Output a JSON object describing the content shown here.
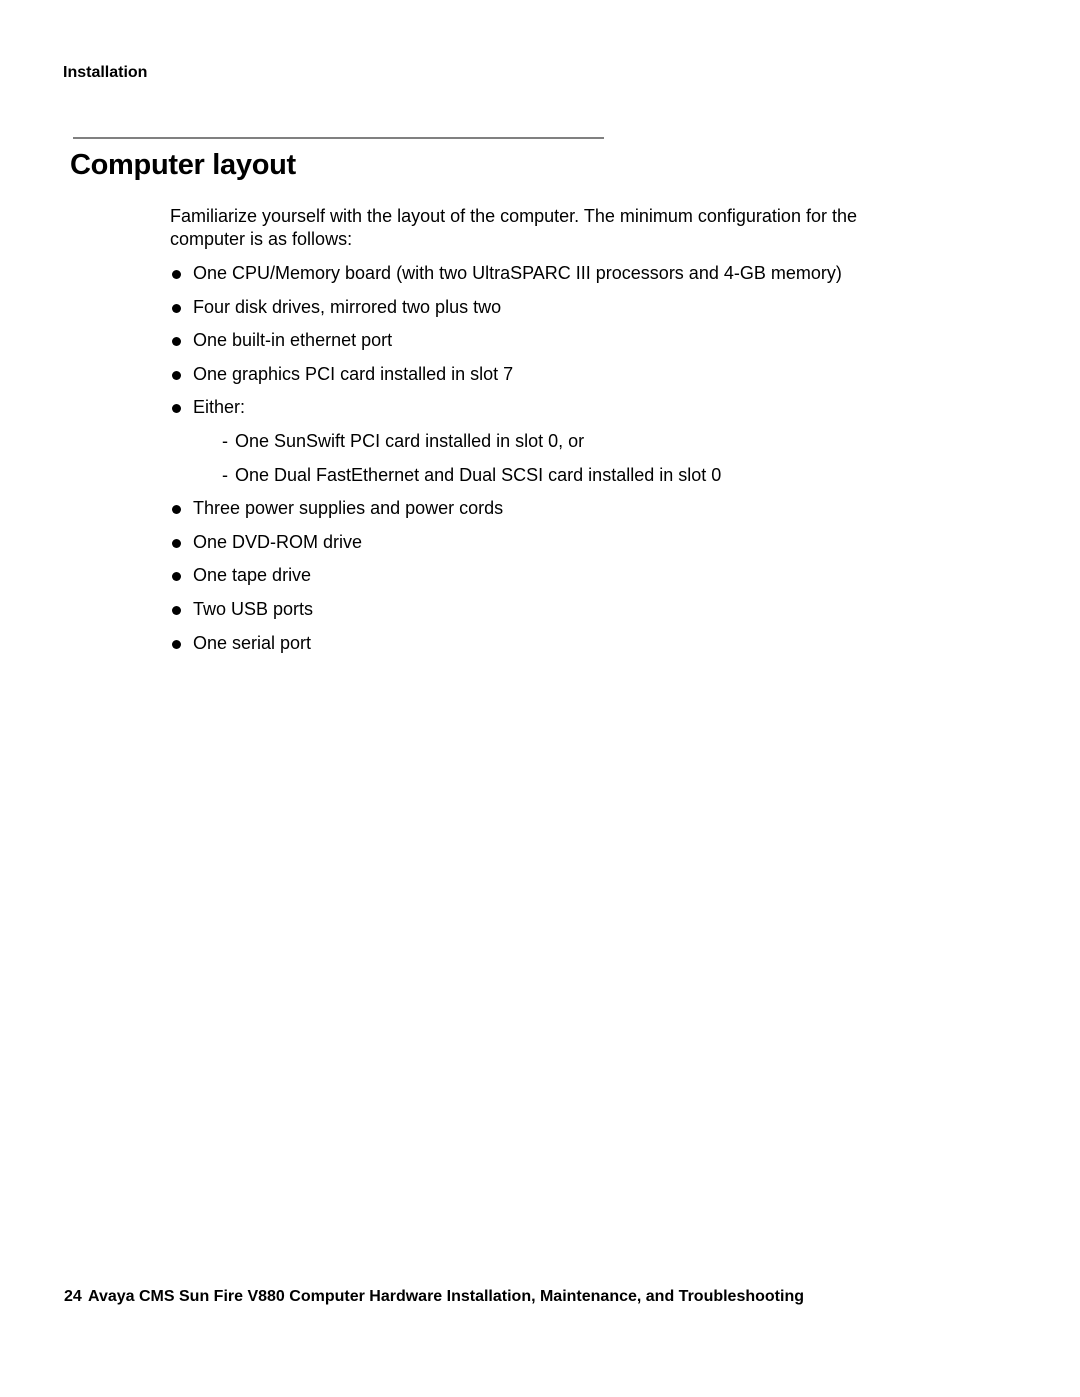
{
  "header": {
    "section": "Installation"
  },
  "page": {
    "title": "Computer layout",
    "intro": "Familiarize yourself with the layout of the computer. The minimum configuration for the computer is as follows:",
    "items": [
      {
        "type": "bullet",
        "text": "One CPU/Memory board (with two UltraSPARC III processors and 4-GB memory)"
      },
      {
        "type": "bullet",
        "text": "Four disk drives, mirrored two plus two"
      },
      {
        "type": "bullet",
        "text": "One built-in ethernet port"
      },
      {
        "type": "bullet",
        "text": "One graphics PCI card installed in slot 7"
      },
      {
        "type": "bullet",
        "text": "Either:"
      },
      {
        "type": "sub",
        "marker": "-",
        "text": "One SunSwift PCI card installed in slot 0, or"
      },
      {
        "type": "sub",
        "marker": "-",
        "text": "One Dual FastEthernet and Dual SCSI card installed in slot 0"
      },
      {
        "type": "bullet",
        "text": "Three power supplies and power cords"
      },
      {
        "type": "bullet",
        "text": "One DVD-ROM drive"
      },
      {
        "type": "bullet",
        "text": "One tape drive"
      },
      {
        "type": "bullet",
        "text": "Two USB ports"
      },
      {
        "type": "bullet",
        "text": "One serial port"
      }
    ]
  },
  "footer": {
    "page_number": "24",
    "book_title": "Avaya CMS Sun Fire V880 Computer Hardware Installation, Maintenance, and Troubleshooting"
  }
}
